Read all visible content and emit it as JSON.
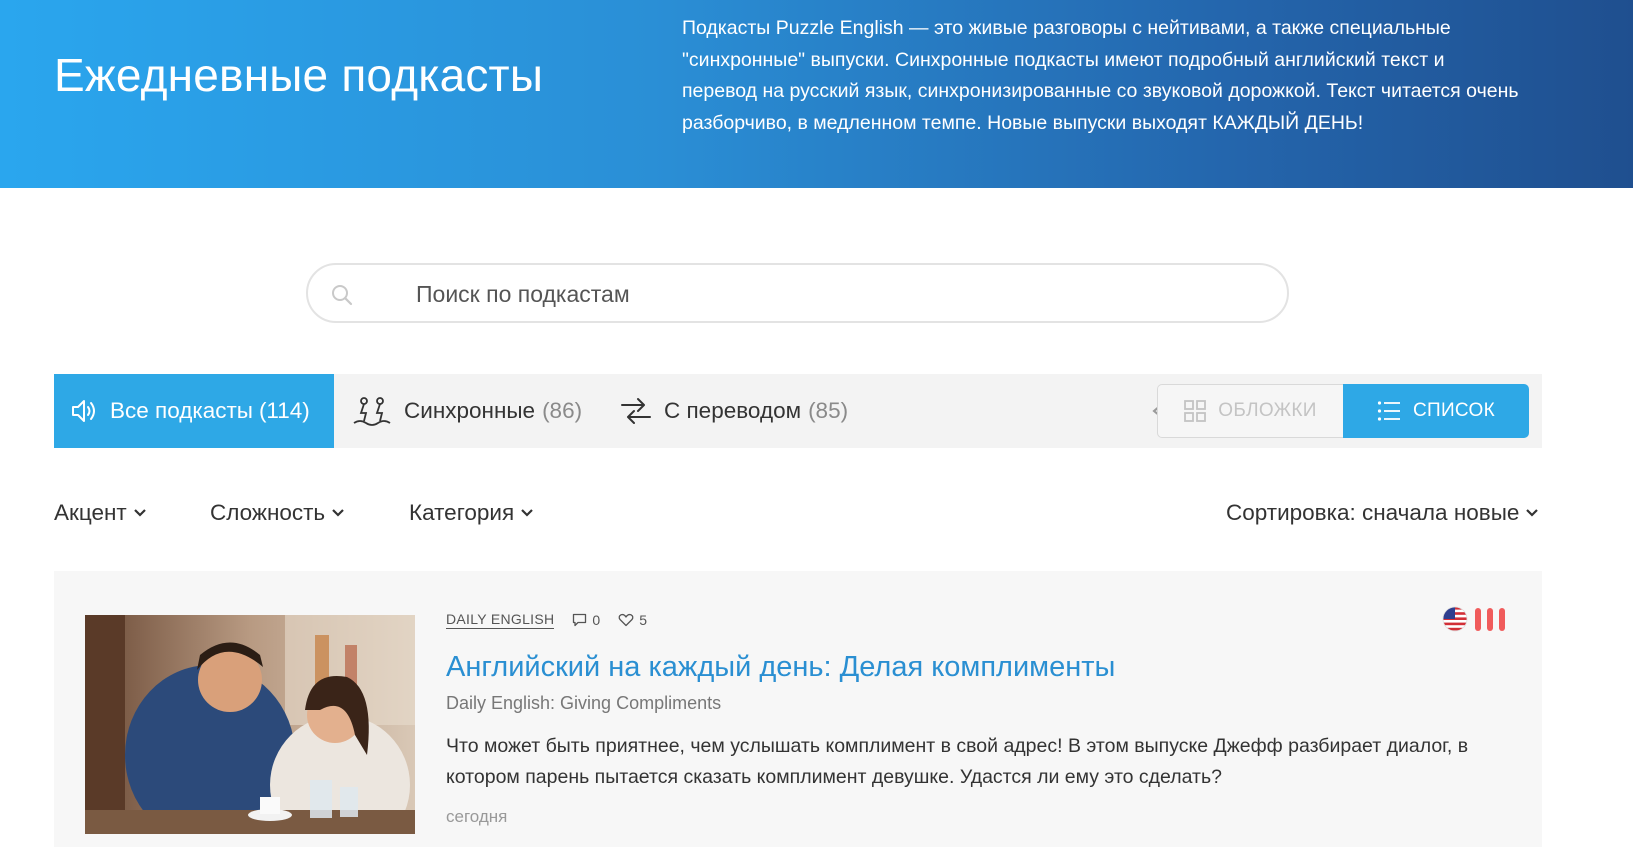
{
  "hero": {
    "title": "Ежедневные подкасты",
    "description": "Подкасты Puzzle English — это живые разговоры с нейтивами, а также специальные \"синхронные\" выпуски. Синхронные подкасты имеют подробный английский текст и перевод на русский язык, синхронизированные со звуковой дорожкой. Текст читается очень разборчиво, в медленном темпе. Новые выпуски выходят КАЖДЫЙ ДЕНЬ!"
  },
  "search": {
    "placeholder": "Поиск по подкастам",
    "value": ""
  },
  "tabs": [
    {
      "label": "Все подкасты",
      "count": "(114)",
      "icon": "speaker-icon",
      "active": true
    },
    {
      "label": "Синхронные",
      "count": "(86)",
      "icon": "sync-icon",
      "active": false
    },
    {
      "label": "С переводом",
      "count": "(85)",
      "icon": "translate-arrows-icon",
      "active": false
    }
  ],
  "view_switch": {
    "covers_label": "ОБЛОЖКИ",
    "list_label": "СПИСОК",
    "active": "list"
  },
  "filters": {
    "accent": "Акцент",
    "difficulty": "Сложность",
    "category": "Категория",
    "sort": "Сортировка: сначала новые"
  },
  "podcasts": [
    {
      "tag": "DAILY ENGLISH",
      "comments": "0",
      "likes": "5",
      "title": "Английский на каждый день: Делая комплименты",
      "subtitle": "Daily English: Giving Compliments",
      "description": "Что может быть приятнее, чем услышать комплимент в свой адрес! В этом выпуске Джефф разбирает диалог, в котором парень пытается сказать комплимент девушке. Удастся ли ему это сделать?",
      "date": "сегодня",
      "accent_flag": "us-flag-icon",
      "level_bars": 3
    }
  ],
  "colors": {
    "accent": "#2ea8e6",
    "title_link": "#2a8fd2",
    "level": "#f05b5b"
  }
}
